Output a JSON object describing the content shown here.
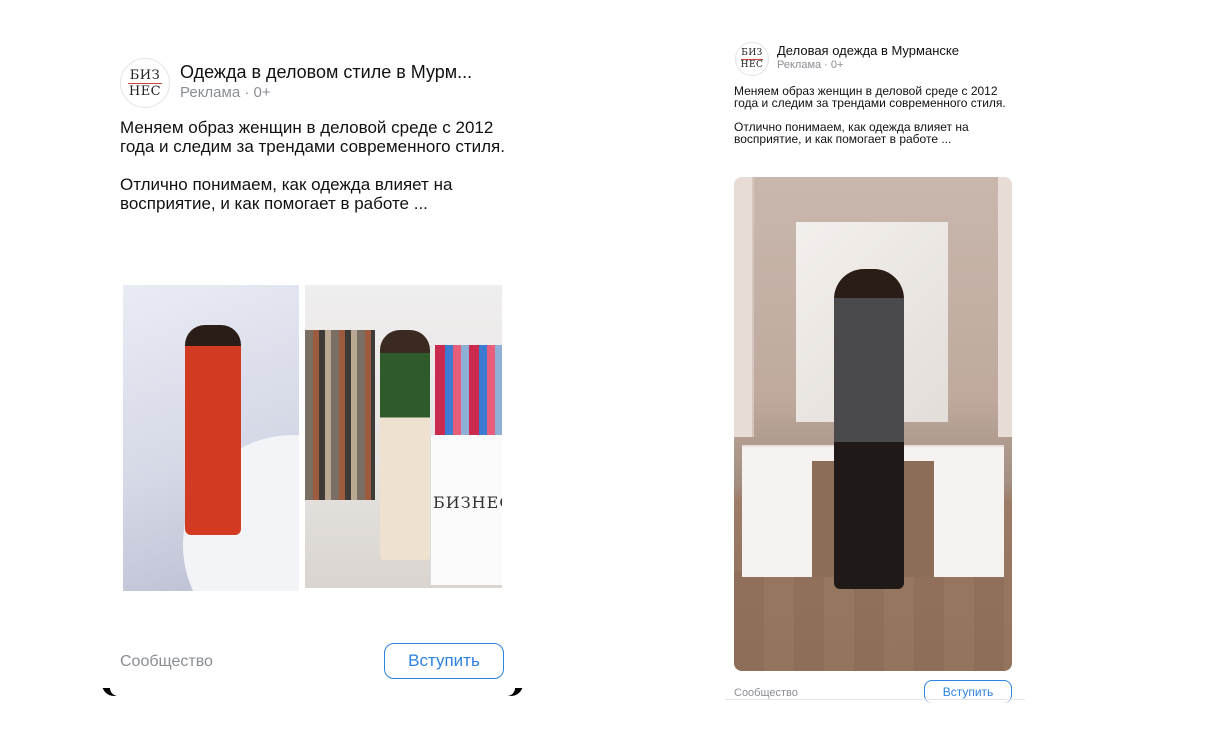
{
  "left_card": {
    "avatar": {
      "line1": "БИЗ",
      "line2": "НЕС"
    },
    "title": "Одежда в деловом стиле в Мурм...",
    "subtitle": "Реклама · 0+",
    "text_p1": "Меняем образ женщин в деловой среде с 2012 года и следим за трендами современного стиля.",
    "text_p2": "Отлично понимаем, как одежда влияет на восприятие, и как помогает в работе ...",
    "image2_brand": "БИЗНЕС",
    "footer_label": "Сообщество",
    "button_label": "Вступить"
  },
  "right_card": {
    "avatar": {
      "line1": "БИЗ",
      "line2": "НЕС"
    },
    "title": "Деловая одежда в Мурманске",
    "subtitle": "Реклама · 0+",
    "text_p1": "Меняем образ женщин в деловой среде с 2012 года и следим за трендами современного стиля.",
    "text_p2": "Отлично понимаем, как одежда влияет на восприятие, и как помогает в работе ...",
    "footer_label": "Сообщество",
    "button_label": "Вступить"
  },
  "colors": {
    "accent": "#2d81e0",
    "muted_text": "#8a8e93"
  }
}
